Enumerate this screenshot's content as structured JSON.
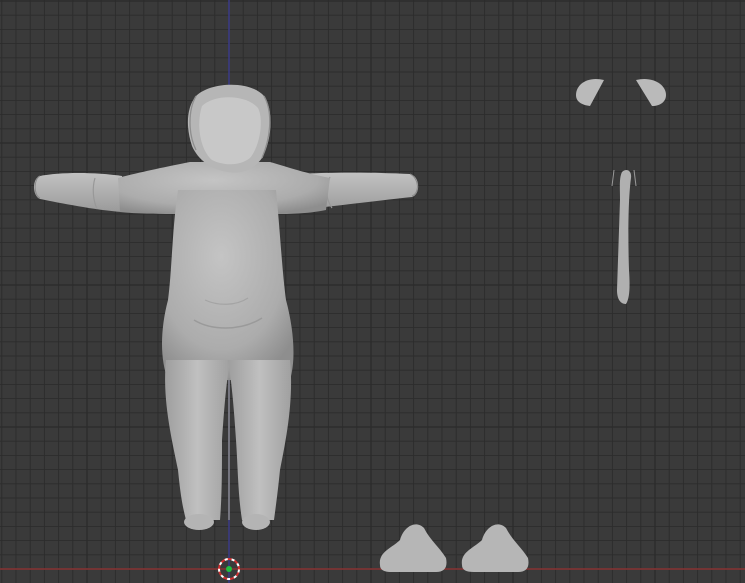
{
  "viewport": {
    "background_color": "#3a3a3a",
    "grid_minor_color": "#414141",
    "grid_major_color": "#2c2c2c",
    "axis_x_color": "#8a3a3a",
    "axis_z_color": "#4a4a8a",
    "mesh_color": "#b8b8b8"
  },
  "scene_objects": [
    {
      "name": "onesie-body",
      "icon": "mesh-object"
    },
    {
      "name": "ears",
      "icon": "mesh-object"
    },
    {
      "name": "tail",
      "icon": "mesh-object"
    },
    {
      "name": "paws",
      "icon": "mesh-object"
    }
  ],
  "cursor_3d": {
    "icon": "3d-cursor-icon"
  }
}
